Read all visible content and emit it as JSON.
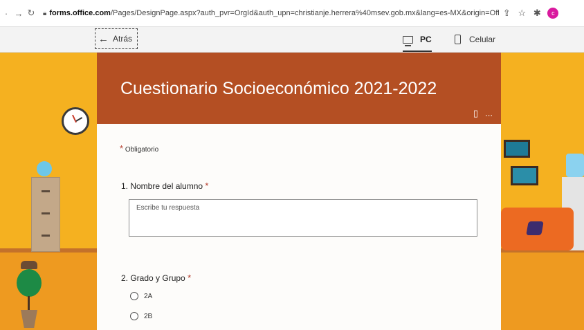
{
  "browser": {
    "url_domain": "forms.office.com",
    "url_path": "/Pages/DesignPage.aspx?auth_pvr=OrgId&auth_upn=christianje.herrera%40msev.gob.mx&lang=es-MX&origin=OfficeDotCom...",
    "avatar_letter": "c"
  },
  "toolbar": {
    "back_label": "Atrás",
    "pc_label": "PC",
    "mobile_label": "Celular"
  },
  "form": {
    "title": "Cuestionario Socioeconómico 2021-2022",
    "required_note": "Obligatorio",
    "required_star": "*",
    "header_more": "...",
    "questions": [
      {
        "label": "1. Nombre del alumno",
        "placeholder": "Escribe tu respuesta"
      },
      {
        "label": "2. Grado y Grupo",
        "options": [
          "2A",
          "2B"
        ]
      }
    ]
  },
  "colors": {
    "header": "#b44f23",
    "background": "#f5b120",
    "required": "#b43a2a"
  }
}
